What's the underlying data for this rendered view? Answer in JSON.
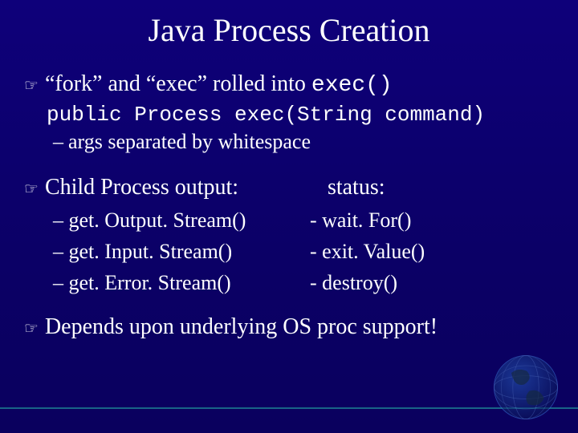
{
  "title": "Java Process Creation",
  "bullets": {
    "b1": {
      "mark": "☞",
      "pre": "“fork” and “exec” rolled into ",
      "code": "exec()"
    },
    "b1_sub_code": "public Process exec(String command)",
    "b1_sub_note": {
      "dash": "–",
      "text": "args separated by whitespace"
    },
    "b2_head": {
      "mark": "☞",
      "left": "Child Process output:",
      "right": "status:"
    },
    "cols": {
      "left": [
        "– get. Output. Stream()",
        "– get. Input. Stream()",
        "– get. Error. Stream()"
      ],
      "right": [
        "- wait. For()",
        "- exit. Value()",
        "- destroy()"
      ]
    },
    "b3": {
      "mark": "☞",
      "text": "Depends upon underlying OS proc support!"
    }
  }
}
